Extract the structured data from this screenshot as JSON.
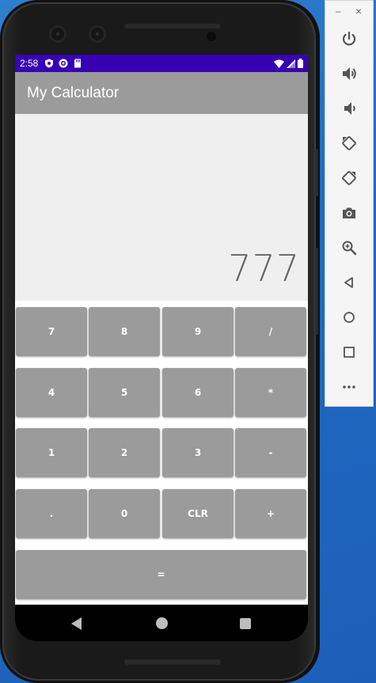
{
  "status_bar": {
    "time": "2:58",
    "background": "#3700b3"
  },
  "app_bar": {
    "title": "My Calculator",
    "background": "#9b9b9b"
  },
  "display": {
    "value": "777"
  },
  "keypad": {
    "rows": [
      [
        "7",
        "8",
        "9",
        "/"
      ],
      [
        "4",
        "5",
        "6",
        "*"
      ],
      [
        "1",
        "2",
        "3",
        "-"
      ],
      [
        ".",
        "0",
        "CLR",
        "+"
      ],
      [
        "="
      ]
    ]
  },
  "emulator_toolbar": {
    "minimize": "–",
    "close": "×",
    "tools": [
      "power-icon",
      "volume-up-icon",
      "volume-down-icon",
      "rotate-left-icon",
      "rotate-right-icon",
      "camera-icon",
      "zoom-icon",
      "back-icon",
      "home-icon",
      "overview-icon",
      "more-icon"
    ]
  },
  "colors": {
    "key": "#9b9b9b",
    "display_bg": "#efefef",
    "display_text": "#666666"
  }
}
